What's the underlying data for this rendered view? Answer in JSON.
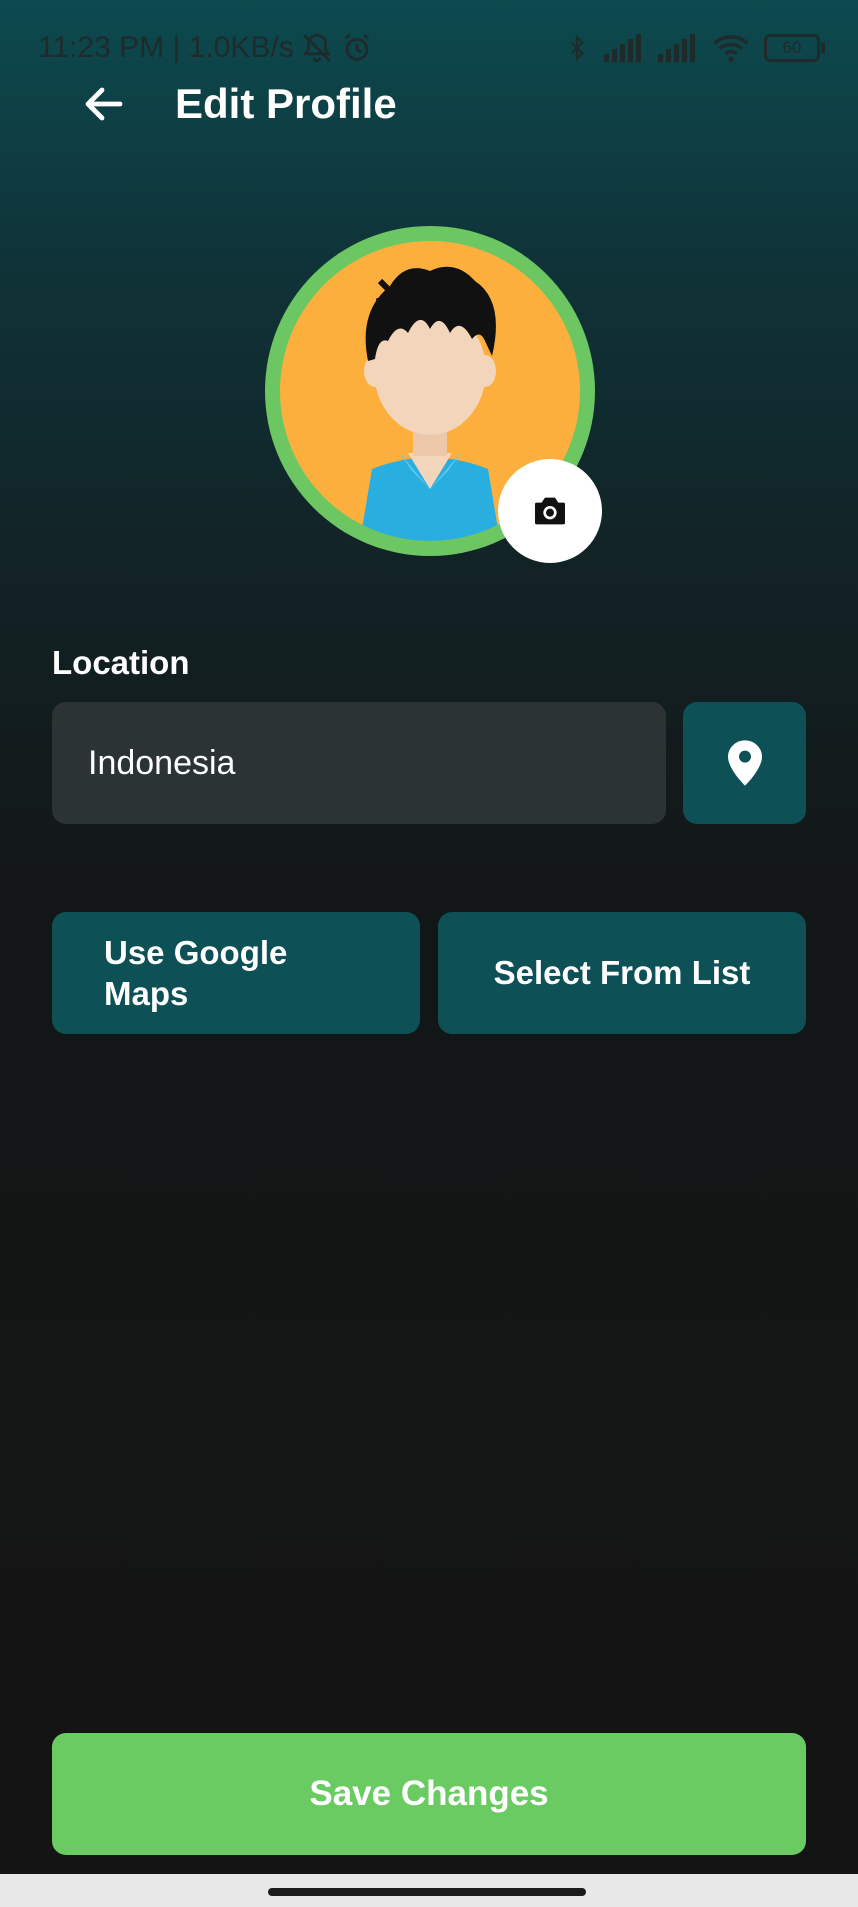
{
  "status_bar": {
    "time_info": "11:23 PM | 1.0KB/s",
    "battery_level": "60",
    "icons": [
      "bell-off-icon",
      "alarm-icon",
      "bluetooth-icon",
      "signal-icon",
      "signal-icon",
      "wifi-icon",
      "battery-icon"
    ]
  },
  "header": {
    "title": "Edit Profile",
    "back_icon": "arrow-left-icon"
  },
  "avatar": {
    "image": "cartoon-boy-avatar",
    "ring_color": "#6cc763",
    "background_color": "#fdaf3d",
    "camera_icon": "camera-icon"
  },
  "location": {
    "label": "Location",
    "value": "Indonesia",
    "pin_icon": "location-pin-icon"
  },
  "options": {
    "google_maps_label": "Use Google Maps",
    "select_list_label": "Select From List"
  },
  "actions": {
    "save_label": "Save Changes"
  },
  "colors": {
    "accent_teal": "#0d5157",
    "primary_green": "#6bcb63",
    "input_bg": "#2c3335",
    "background": "#141414"
  }
}
